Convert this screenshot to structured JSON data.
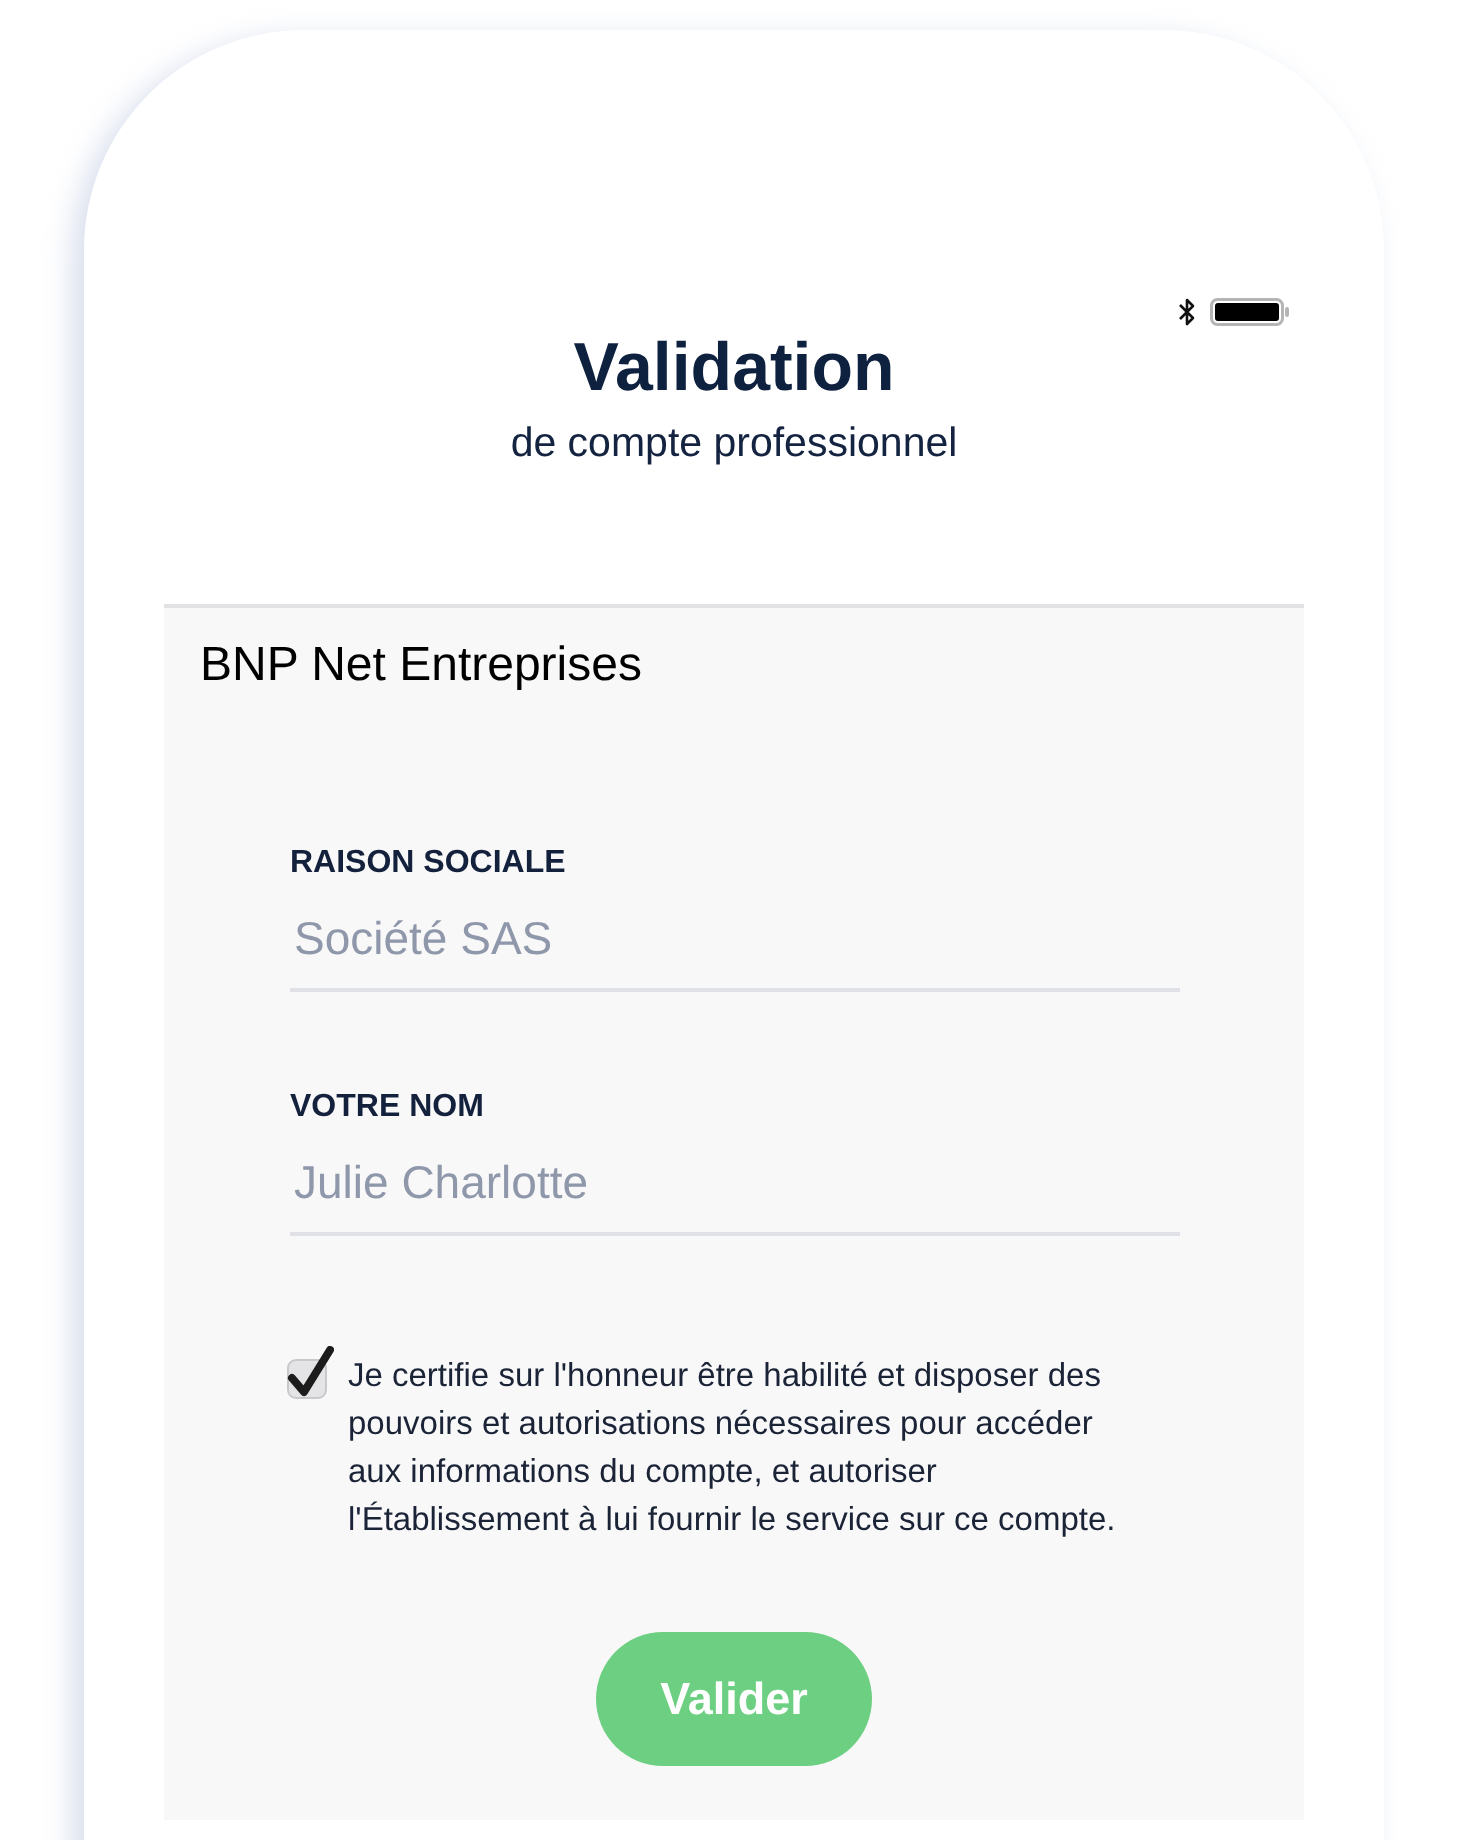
{
  "header": {
    "title": "Validation",
    "subtitle": "de compte professionnel"
  },
  "section_title": "BNP Net Entreprises",
  "fields": [
    {
      "label": "RAISON SOCIALE",
      "placeholder": "Société SAS"
    },
    {
      "label": "VOTRE NOM",
      "placeholder": "Julie Charlotte"
    }
  ],
  "consent": {
    "checked": true,
    "text": "Je certifie sur l'honneur être habilité et disposer des pouvoirs et autorisations nécessaires pour accéder aux informations du compte, et autoriser l'Établissement à lui fournir le service sur ce compte."
  },
  "submit_button": {
    "label": "Valider"
  }
}
